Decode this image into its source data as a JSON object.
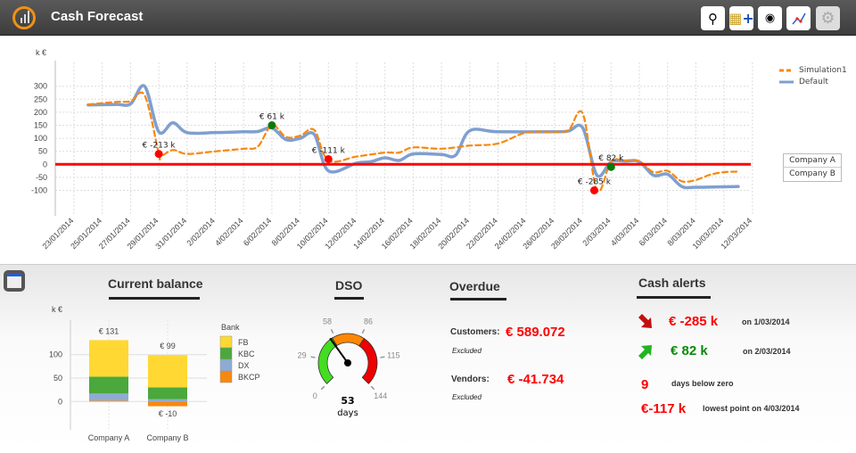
{
  "header": {
    "title": "Cash Forecast",
    "buttons": [
      {
        "icon": "search-icon",
        "glyph": "🔍"
      },
      {
        "icon": "add-coins-icon",
        "glyph": "➕"
      },
      {
        "icon": "user-icon",
        "glyph": "◉"
      },
      {
        "icon": "line-chart-icon",
        "glyph": "📈"
      },
      {
        "icon": "gear-icon",
        "glyph": "⚙"
      }
    ]
  },
  "chart_data": [
    {
      "type": "line",
      "ylabel": "k €",
      "ylim": [
        -100,
        300
      ],
      "yticks": [
        300,
        250,
        200,
        150,
        100,
        50,
        0,
        -50,
        -100
      ],
      "xticks": [
        "23/01/2014",
        "25/01/2014",
        "27/01/2014",
        "29/01/2014",
        "31/01/2014",
        "2/02/2014",
        "4/02/2014",
        "6/02/2014",
        "8/02/2014",
        "10/02/2014",
        "12/02/2014",
        "14/02/2014",
        "16/02/2014",
        "18/02/2014",
        "20/02/2014",
        "22/02/2014",
        "24/02/2014",
        "26/02/2014",
        "28/02/2014",
        "2/03/2014",
        "4/03/2014",
        "6/03/2014",
        "8/03/2014",
        "10/03/2014",
        "12/03/2014"
      ],
      "grid": true,
      "legend": "top-right",
      "threshold": 0,
      "colors": {
        "Simulation1": "#f7880f",
        "Default": "#7f9fcf",
        "threshold": "#ff0000"
      },
      "series": [
        {
          "name": "Simulation1",
          "style": "dashed",
          "points": [
            [
              "24/01/2014",
              230
            ],
            [
              "26/01/2014",
              240
            ],
            [
              "27/01/2014",
              242
            ],
            [
              "28/01/2014",
              265
            ],
            [
              "29/01/2014",
              40
            ],
            [
              "29/01/2014",
              30
            ],
            [
              "30/01/2014",
              55
            ],
            [
              "31/01/2014",
              40
            ],
            [
              "2/02/2014",
              50
            ],
            [
              "4/02/2014",
              60
            ],
            [
              "5/02/2014",
              68
            ],
            [
              "6/02/2014",
              150
            ],
            [
              "7/02/2014",
              105
            ],
            [
              "8/02/2014",
              110
            ],
            [
              "9/02/2014",
              132
            ],
            [
              "10/02/2014",
              15
            ],
            [
              "12/02/2014",
              30
            ],
            [
              "14/02/2014",
              45
            ],
            [
              "15/02/2014",
              45
            ],
            [
              "16/02/2014",
              65
            ],
            [
              "18/02/2014",
              60
            ],
            [
              "20/02/2014",
              72
            ],
            [
              "22/02/2014",
              80
            ],
            [
              "24/02/2014",
              122
            ],
            [
              "26/02/2014",
              125
            ],
            [
              "27/02/2014",
              132
            ],
            [
              "28/02/2014",
              195
            ],
            [
              "1/03/2014",
              -100
            ],
            [
              "2/03/2014",
              10
            ],
            [
              "3/03/2014",
              15
            ],
            [
              "4/03/2014",
              12
            ],
            [
              "5/03/2014",
              -30
            ],
            [
              "6/03/2014",
              -25
            ],
            [
              "7/03/2014",
              -65
            ],
            [
              "8/03/2014",
              -60
            ],
            [
              "9/03/2014",
              -40
            ],
            [
              "10/03/2014",
              -30
            ],
            [
              "11/03/2014",
              -28
            ]
          ]
        },
        {
          "name": "Default",
          "style": "solid",
          "points": [
            [
              "24/01/2014",
              228
            ],
            [
              "26/01/2014",
              230
            ],
            [
              "27/01/2014",
              232
            ],
            [
              "28/01/2014",
              300
            ],
            [
              "29/01/2014",
              125
            ],
            [
              "30/01/2014",
              160
            ],
            [
              "31/01/2014",
              122
            ],
            [
              "2/02/2014",
              122
            ],
            [
              "4/02/2014",
              125
            ],
            [
              "5/02/2014",
              126
            ],
            [
              "6/02/2014",
              140
            ],
            [
              "7/02/2014",
              95
            ],
            [
              "8/02/2014",
              100
            ],
            [
              "9/02/2014",
              115
            ],
            [
              "10/02/2014",
              -25
            ],
            [
              "12/02/2014",
              5
            ],
            [
              "13/02/2014",
              10
            ],
            [
              "14/02/2014",
              25
            ],
            [
              "15/02/2014",
              15
            ],
            [
              "16/02/2014",
              40
            ],
            [
              "18/02/2014",
              38
            ],
            [
              "19/02/2014",
              35
            ],
            [
              "20/02/2014",
              129
            ],
            [
              "22/02/2014",
              125
            ],
            [
              "26/02/2014",
              125
            ],
            [
              "27/02/2014",
              128
            ],
            [
              "28/02/2014",
              140
            ],
            [
              "1/03/2014",
              -42
            ],
            [
              "2/03/2014",
              10
            ],
            [
              "3/03/2014",
              12
            ],
            [
              "4/03/2014",
              10
            ],
            [
              "5/03/2014",
              -42
            ],
            [
              "6/03/2014",
              -38
            ],
            [
              "7/03/2014",
              -85
            ],
            [
              "8/03/2014",
              -88
            ],
            [
              "11/03/2014",
              -85
            ]
          ]
        }
      ],
      "markers": [
        {
          "date": "29/01/2014",
          "value": 40,
          "label": "€ -213 k",
          "color": "#ff0000"
        },
        {
          "date": "6/02/2014",
          "value": 150,
          "label": "€ 61 k",
          "color": "#0a7a0a"
        },
        {
          "date": "10/02/2014",
          "value": 20,
          "label": "€ -111 k",
          "color": "#ff0000"
        },
        {
          "date": "1/03/2014",
          "value": -100,
          "label": "€ -285 k",
          "color": "#ff0000"
        },
        {
          "date": "2/03/2014",
          "value": -10,
          "label": "€ 82 k",
          "color": "#0a7a0a"
        }
      ]
    },
    {
      "type": "bar",
      "stacked": true,
      "title": "Current balance",
      "ylabel": "k €",
      "yticks": [
        100,
        50,
        0
      ],
      "legend_title": "Bank",
      "legend": "right",
      "categories": [
        "Company A",
        "Company B"
      ],
      "totals": [
        "€ 131",
        "€ 99"
      ],
      "negative_label": "€ -10",
      "series": [
        {
          "name": "FB",
          "color": "#ffd833",
          "values": [
            78,
            69
          ]
        },
        {
          "name": "KBC",
          "color": "#4aa83c",
          "values": [
            36,
            25
          ]
        },
        {
          "name": "DX",
          "color": "#8fabd3",
          "values": [
            15,
            5
          ]
        },
        {
          "name": "BKCP",
          "color": "#f7880f",
          "values": [
            2,
            -10
          ]
        }
      ]
    }
  ],
  "companies": [
    "Company A",
    "Company B"
  ],
  "dso": {
    "title": "DSO",
    "value": 53,
    "unit": "days",
    "max": 144,
    "ticks": [
      "0",
      "29",
      "58",
      "86",
      "115",
      "144"
    ],
    "bands": [
      {
        "to": 55,
        "color": "#44dd22"
      },
      {
        "to": 90,
        "color": "#ff8800"
      },
      {
        "to": 144,
        "color": "#ee0000"
      }
    ]
  },
  "overdue": {
    "title": "Overdue",
    "customers_label": "Customers:",
    "customers_value": "€ 589.072",
    "customers_note": "Excluded",
    "vendors_label": "Vendors:",
    "vendors_value": "€ -41.734",
    "vendors_note": "Excluded"
  },
  "alerts": {
    "title": "Cash alerts",
    "low_value": "€ -285 k",
    "low_date": "on 1/03/2014",
    "high_value": "€ 82 k",
    "high_date": "on 2/03/2014",
    "days_below": "9",
    "days_below_label": "days below zero",
    "lowest_value": "€-117 k",
    "lowest_label": "lowest point on 4/03/2014"
  }
}
